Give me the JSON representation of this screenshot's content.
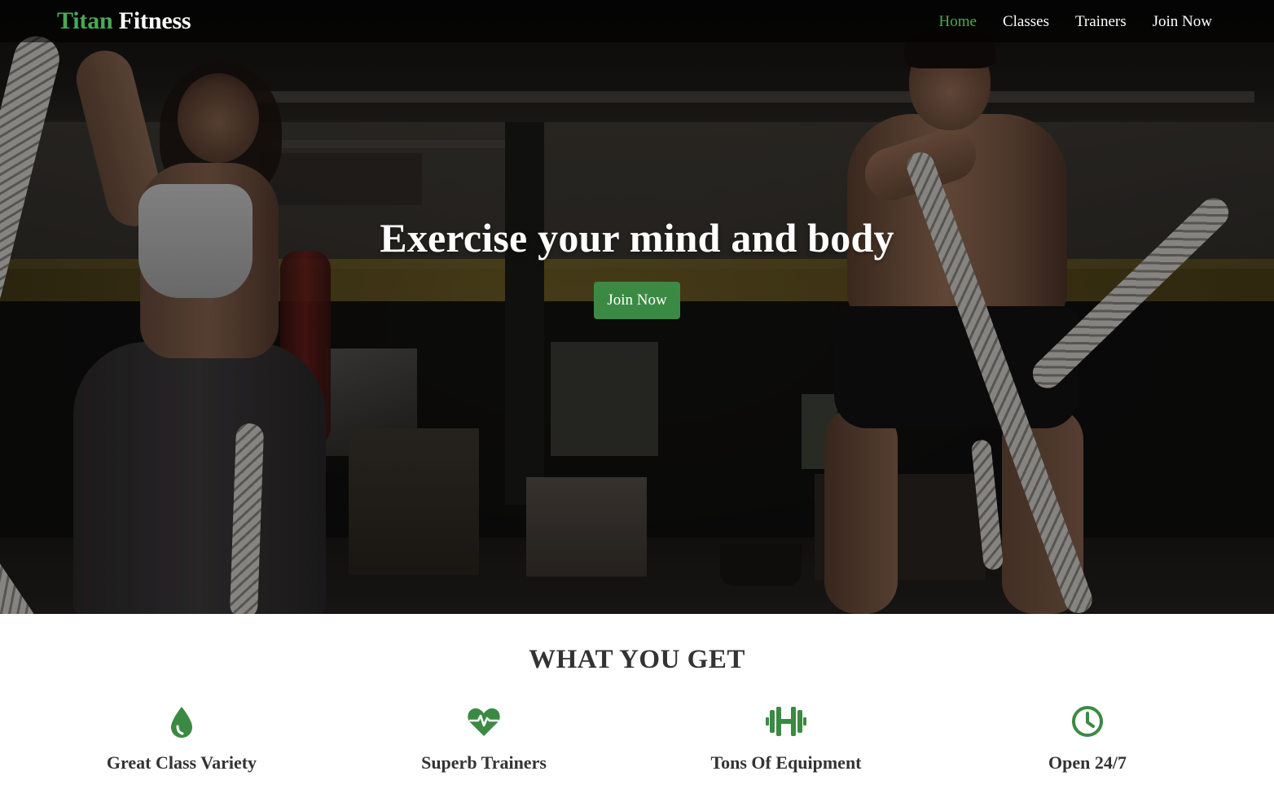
{
  "nav": {
    "brand_first": "Titan",
    "brand_second": "Fitness",
    "links": [
      {
        "label": "Home",
        "active": true
      },
      {
        "label": "Classes",
        "active": false
      },
      {
        "label": "Trainers",
        "active": false
      },
      {
        "label": "Join Now",
        "active": false
      }
    ]
  },
  "hero": {
    "title": "Exercise your mind and body",
    "button_label": "Join Now"
  },
  "features": {
    "title": "WHAT YOU GET",
    "items": [
      {
        "label": "Great Class Variety",
        "icon": "droplet-icon"
      },
      {
        "label": "Superb Trainers",
        "icon": "heartbeat-icon"
      },
      {
        "label": "Tons Of Equipment",
        "icon": "dumbbell-icon"
      },
      {
        "label": "Open 24/7",
        "icon": "clock-icon"
      }
    ]
  },
  "colors": {
    "accent_green": "#4aa856",
    "button_green": "#3b8a44",
    "icon_green": "#3b8a44",
    "text_dark": "#333333"
  }
}
